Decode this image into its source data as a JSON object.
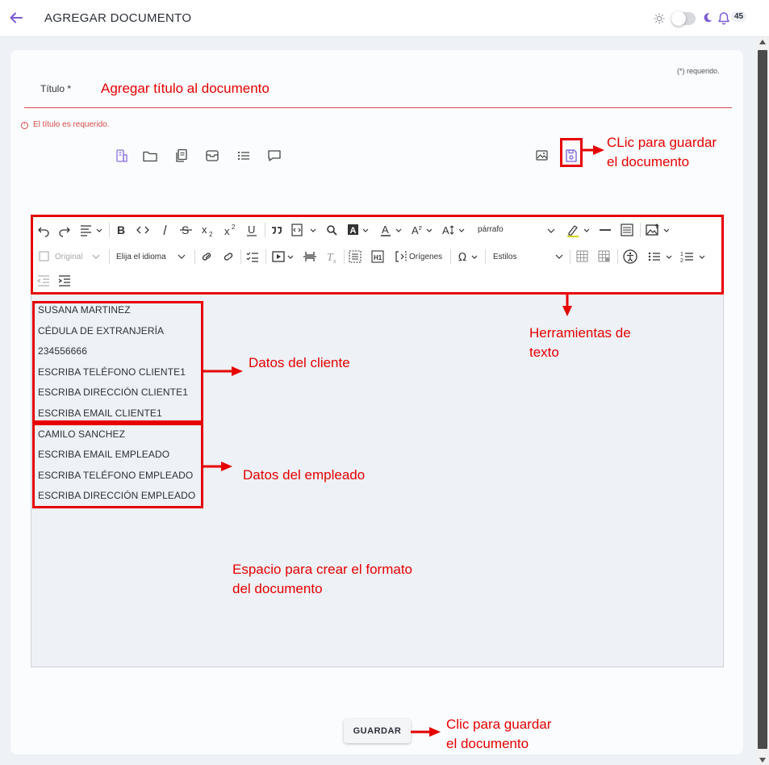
{
  "header": {
    "title": "AGREGAR DOCUMENTO",
    "notification_count": "45",
    "accent_color": "#7b5cd6"
  },
  "form": {
    "required_note": "(*) requerido.",
    "title_label": "Título *",
    "title_error": "El título es requerido."
  },
  "toolbar": {
    "paragraph_select": "párrafo",
    "original_select": "Original",
    "language_select": "Elija el idioma",
    "origins_label": "Orígenes",
    "styles_select": "Estilos"
  },
  "document_lines": [
    "SUSANA MARTINEZ",
    "CÉDULA DE EXTRANJERÍA",
    "234556666",
    "ESCRIBA TELÉFONO CLIENTE1",
    "ESCRIBA DIRECCIÓN CLIENTE1",
    "ESCRIBA EMAIL CLIENTE1",
    "CAMILO SANCHEZ",
    "ESCRIBA EMAIL EMPLEADO",
    "ESCRIBA TELÉFONO EMPLEADO",
    "ESCRIBA DIRECCIÓN EMPLEADO"
  ],
  "annotations": {
    "add_title": "Agregar título al documento",
    "save_top": [
      "CLic para guardar",
      "el documento"
    ],
    "text_tools": [
      "Herramientas de",
      "texto"
    ],
    "client_data": "Datos del cliente",
    "employee_data": "Datos del empleado",
    "format_space": [
      "Espacio para crear el formato",
      "del documento"
    ],
    "save_bottom": [
      "Clic para guardar",
      "el documento"
    ],
    "color": "#e60000"
  },
  "footer": {
    "save_button": "GUARDAR"
  }
}
